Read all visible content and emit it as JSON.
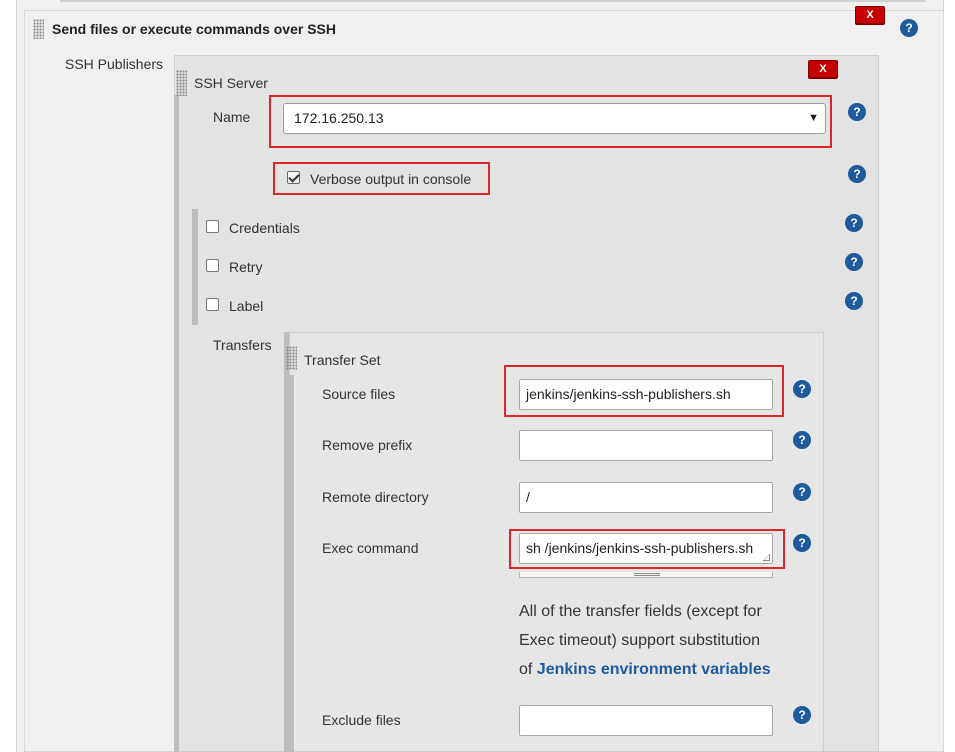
{
  "section": {
    "title": "Send files or execute commands over SSH",
    "delete_label": "X",
    "help_label": "?"
  },
  "publishers": {
    "label": "SSH Publishers"
  },
  "server": {
    "title": "SSH Server",
    "delete_label": "X",
    "name_label": "Name",
    "name_value": "172.16.250.13",
    "verbose_label": "Verbose output in console",
    "verbose_checked": true,
    "options": [
      {
        "label": "Credentials",
        "checked": false
      },
      {
        "label": "Retry",
        "checked": false
      },
      {
        "label": "Label",
        "checked": false
      }
    ],
    "transfers_label": "Transfers"
  },
  "transfer_set": {
    "title": "Transfer Set",
    "source_files_label": "Source files",
    "source_files_value": "jenkins/jenkins-ssh-publishers.sh",
    "remove_prefix_label": "Remove prefix",
    "remove_prefix_value": "",
    "remote_directory_label": "Remote directory",
    "remote_directory_value": "/",
    "exec_command_label": "Exec command",
    "exec_command_value": "sh /jenkins/jenkins-ssh-publishers.sh",
    "info_text_1": "All of the transfer fields (except for",
    "info_text_2": "Exec timeout) support substitution",
    "info_text_3_prefix": "of ",
    "info_link": "Jenkins environment variables",
    "exclude_files_label": "Exclude files",
    "exclude_files_value": ""
  },
  "colors": {
    "highlight": "#d9262b",
    "help_icon": "#1e5a9c",
    "delete_button": "#c40000",
    "link": "#1e5a9c"
  }
}
